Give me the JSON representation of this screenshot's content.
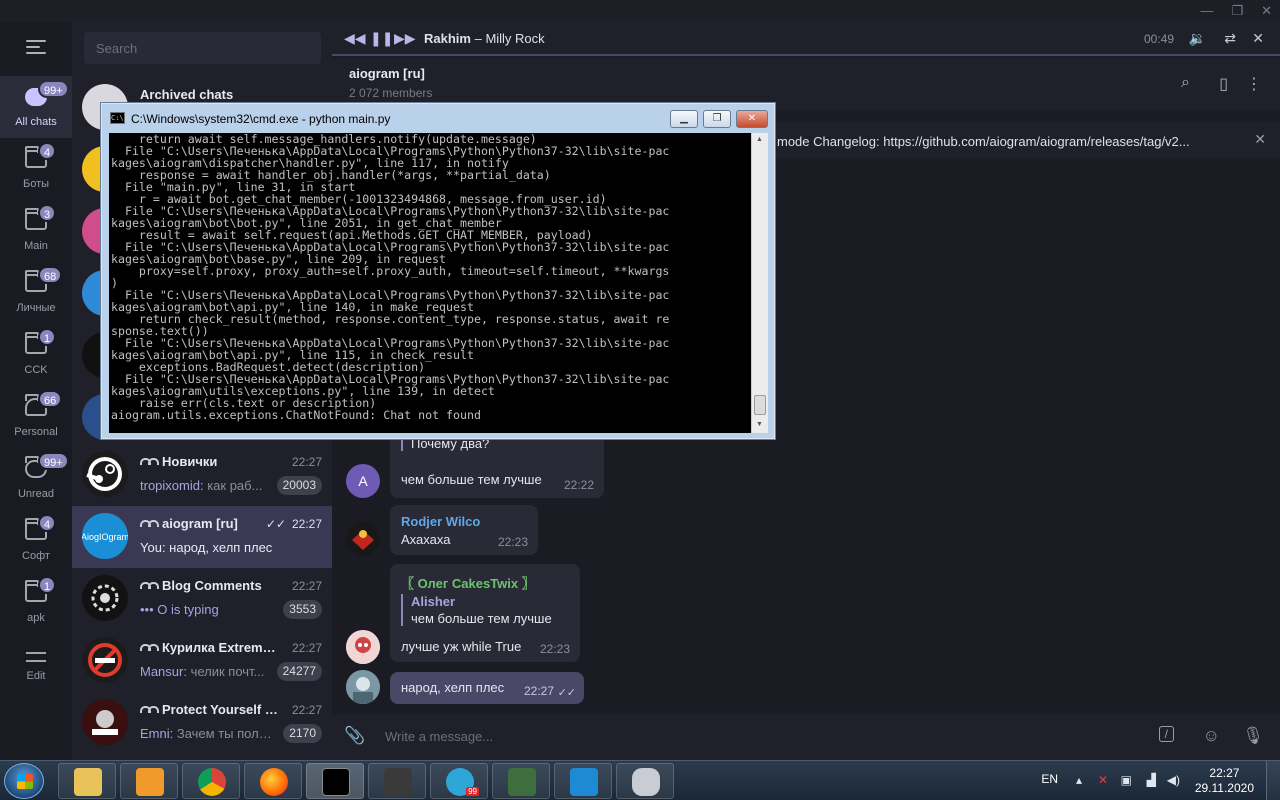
{
  "window": {
    "controls": [
      "—",
      "❐",
      "✕"
    ]
  },
  "sidebar": {
    "folders": [
      {
        "label": "All chats",
        "badge": "99+",
        "icon": "chat-bubbles-icon"
      },
      {
        "label": "Боты",
        "badge": "4",
        "icon": "folder-icon"
      },
      {
        "label": "Main",
        "badge": "3",
        "icon": "folder-icon"
      },
      {
        "label": "Личные",
        "badge": "68",
        "icon": "folder-icon"
      },
      {
        "label": "CCK",
        "badge": "1",
        "icon": "folder-icon"
      },
      {
        "label": "Personal",
        "badge": "66",
        "icon": "person-icon"
      },
      {
        "label": "Unread",
        "badge": "99+",
        "icon": "chat-icon"
      },
      {
        "label": "Софт",
        "badge": "4",
        "icon": "folder-icon"
      },
      {
        "label": "apk",
        "badge": "1",
        "icon": "folder-icon"
      }
    ],
    "edit_label": "Edit"
  },
  "chatlist": {
    "search_placeholder": "Search",
    "archived_label": "Archived chats",
    "chats": [
      {
        "name": "Новички",
        "time": "22:27",
        "sender": "tropixomid:",
        "preview": " как раб...",
        "badge": "20003",
        "avatar_color": "#1b1b1b"
      },
      {
        "name": "aiogram [ru]",
        "time": "22:27",
        "sender": "",
        "preview": "You: народ, хелп плес",
        "badge": "",
        "avatar_color": "#1a8fd6",
        "avatar_text": "AiogIOgram"
      },
      {
        "name": "Blog Comments",
        "time": "22:27",
        "sender": "",
        "preview": "••• O is typing",
        "badge": "3553",
        "avatar_color": "#121212"
      },
      {
        "name": "Курилка Extreme...",
        "time": "22:27",
        "sender": "Mansur:",
        "preview": " челик почт...",
        "badge": "24277",
        "avatar_color": "#1b1b1b"
      },
      {
        "name": "Protect Yourself C...",
        "time": "22:27",
        "sender": "Emni:",
        "preview": " Зачем ты поль...",
        "badge": "2170",
        "avatar_color": "#2a0c0c"
      }
    ]
  },
  "player": {
    "artist": "Rakhim",
    "separator": " – ",
    "track": "Milly Rock",
    "time": "00:49"
  },
  "chat": {
    "title": "aiogram [ru]",
    "members": "2 072 members",
    "pinned": "mode  Changelog: https://github.com/aiogram/aiogram/releases/tag/v2...",
    "messages": {
      "m1_quote": "Почему два?",
      "m1_text": "чем больше тем лучше",
      "m1_time": "22:22",
      "m1_avatar": "A",
      "m2_sender": "Rodjer Wilco",
      "m2_text": "Ахахаха",
      "m2_time": "22:23",
      "m3_sender": "〖 Олег CakesTwix 〗",
      "m3_reply_name": "Alisher",
      "m3_reply_text": "чем больше тем лучше",
      "m3_text": "лучше уж while True",
      "m3_time": "22:23",
      "m4_text": "народ, хелп плес",
      "m4_time": "22:27"
    },
    "composer_placeholder": "Write a message..."
  },
  "cmd": {
    "title": "C:\\Windows\\system32\\cmd.exe - python  main.py",
    "lines": [
      "    return await self.message_handlers.notify(update.message)",
      "  File \"C:\\Users\\Печенька\\AppData\\Local\\Programs\\Python\\Python37-32\\lib\\site-pac",
      "kages\\aiogram\\dispatcher\\handler.py\", line 117, in notify",
      "    response = await handler_obj.handler(*args, **partial_data)",
      "  File \"main.py\", line 31, in start",
      "    r = await bot.get_chat_member(-1001323494868, message.from_user.id)",
      "  File \"C:\\Users\\Печенька\\AppData\\Local\\Programs\\Python\\Python37-32\\lib\\site-pac",
      "kages\\aiogram\\bot\\bot.py\", line 2051, in get_chat_member",
      "    result = await self.request(api.Methods.GET_CHAT_MEMBER, payload)",
      "  File \"C:\\Users\\Печенька\\AppData\\Local\\Programs\\Python\\Python37-32\\lib\\site-pac",
      "kages\\aiogram\\bot\\base.py\", line 209, in request",
      "    proxy=self.proxy, proxy_auth=self.proxy_auth, timeout=self.timeout, **kwargs",
      ")",
      "  File \"C:\\Users\\Печенька\\AppData\\Local\\Programs\\Python\\Python37-32\\lib\\site-pac",
      "kages\\aiogram\\bot\\api.py\", line 140, in make_request",
      "    return check_result(method, response.content_type, response.status, await re",
      "sponse.text())",
      "  File \"C:\\Users\\Печенька\\AppData\\Local\\Programs\\Python\\Python37-32\\lib\\site-pac",
      "kages\\aiogram\\bot\\api.py\", line 115, in check_result",
      "    exceptions.BadRequest.detect(description)",
      "  File \"C:\\Users\\Печенька\\AppData\\Local\\Programs\\Python\\Python37-32\\lib\\site-pac",
      "kages\\aiogram\\utils\\exceptions.py\", line 139, in detect",
      "    raise err(cls.text or description)",
      "aiogram.utils.exceptions.ChatNotFound: Chat not found"
    ]
  },
  "taskbar": {
    "apps": [
      "file-explorer-icon",
      "media-player-icon",
      "chrome-icon",
      "firefox-icon",
      "cmd-icon",
      "terminal-icon",
      "telegram-icon",
      "task-manager-icon",
      "vscode-icon",
      "database-icon"
    ],
    "telegram_badge": "99",
    "lang": "EN",
    "time": "22:27",
    "date": "29.11.2020"
  },
  "colors": {
    "accent": "#8a87bd",
    "selected": "#3a3852",
    "outgoing": "#4a4866"
  }
}
